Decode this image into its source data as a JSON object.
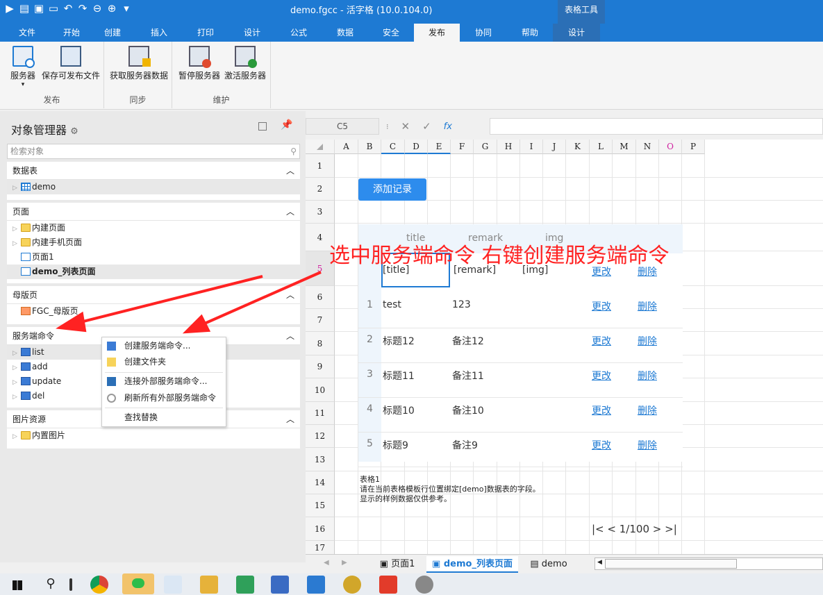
{
  "window": {
    "title": "demo.fgcc - 活字格 (10.0.104.0)",
    "context_tab": "表格工具"
  },
  "menu": [
    "文件",
    "开始",
    "创建",
    "插入",
    "打印",
    "设计",
    "公式",
    "数据",
    "安全",
    "发布",
    "协同",
    "帮助",
    "设计"
  ],
  "ribbon": {
    "groups": [
      {
        "label": "发布",
        "buttons": [
          "服务器",
          "保存可发布文件"
        ]
      },
      {
        "label": "同步",
        "buttons": [
          "获取服务器数据"
        ]
      },
      {
        "label": "维护",
        "buttons": [
          "暂停服务器",
          "激活服务器"
        ]
      }
    ],
    "dropdown_marker": "▾"
  },
  "object_manager": {
    "title": "对象管理器",
    "search_placeholder": "检索对象",
    "sections": {
      "tables": {
        "title": "数据表",
        "items": [
          "demo"
        ]
      },
      "pages": {
        "title": "页面",
        "items": [
          "内建页面",
          "内建手机页面",
          "页面1",
          "demo_列表页面"
        ]
      },
      "master": {
        "title": "母版页",
        "items": [
          "FGC_母版页"
        ]
      },
      "server": {
        "title": "服务端命令",
        "items": [
          "list",
          "add",
          "update",
          "del"
        ]
      },
      "images": {
        "title": "图片资源",
        "items": [
          "内置图片"
        ]
      }
    }
  },
  "context_menu": {
    "items": [
      "创建服务端命令...",
      "创建文件夹",
      "连接外部服务端命令...",
      "刷新所有外部服务端命令",
      "查找替换"
    ]
  },
  "formula_bar": {
    "cell_ref": "C5",
    "fx": "fx"
  },
  "grid": {
    "columns": [
      "A",
      "B",
      "C",
      "D",
      "E",
      "F",
      "G",
      "H",
      "I",
      "J",
      "K",
      "L",
      "M",
      "N",
      "O",
      "P"
    ],
    "rows": [
      "1",
      "2",
      "3",
      "4",
      "5",
      "6",
      "7",
      "8",
      "9",
      "10",
      "11",
      "12",
      "13",
      "14",
      "15",
      "16",
      "17"
    ],
    "add_button": "添加记录",
    "header": {
      "title": "title",
      "remark": "remark",
      "img": "img"
    },
    "template": {
      "title": "[title]",
      "remark": "[remark]",
      "img": "[img]",
      "edit": "更改",
      "delete": "删除"
    },
    "records": [
      {
        "n": "1",
        "title": "test",
        "remark": "123"
      },
      {
        "n": "2",
        "title": "标题12",
        "remark": "备注12"
      },
      {
        "n": "3",
        "title": "标题11",
        "remark": "备注11"
      },
      {
        "n": "4",
        "title": "标题10",
        "remark": "备注10"
      },
      {
        "n": "5",
        "title": "标题9",
        "remark": "备注9"
      }
    ],
    "note": [
      "表格1",
      "请在当前表格模板行位置绑定[demo]数据表的字段。",
      "显示的样例数据仅供参考。"
    ],
    "pager": "1/100"
  },
  "annotation": "选中服务端命令 右键创建服务端命令",
  "sheet_tabs": [
    "页面1",
    "demo_列表页面",
    "demo"
  ],
  "colors": {
    "accent": "#1e7ad3",
    "annotation": "#ff2222"
  }
}
